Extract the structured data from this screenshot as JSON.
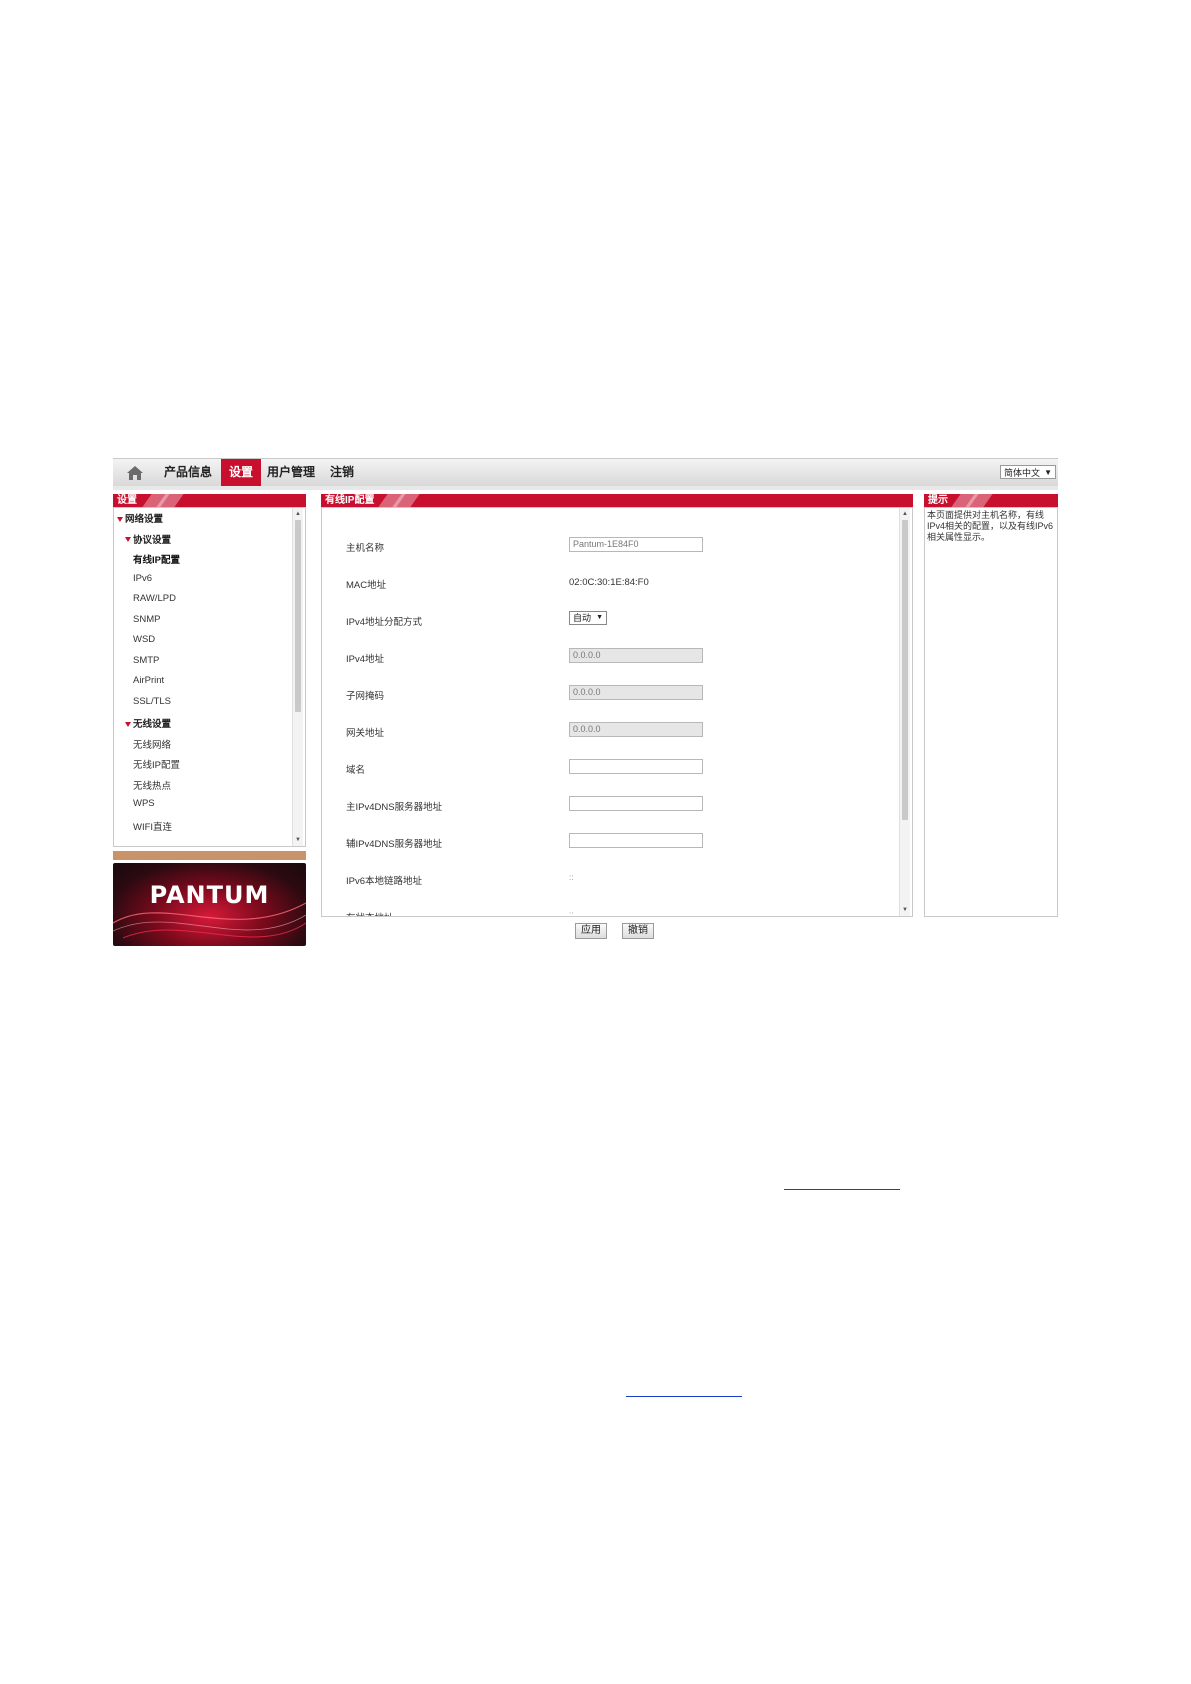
{
  "nav": {
    "items": [
      "产品信息",
      "设置",
      "用户管理",
      "注销"
    ],
    "active_index": 1,
    "language": "简体中文"
  },
  "sidebar": {
    "title": "设置",
    "tree": [
      {
        "label": "网络设置",
        "kind": "group",
        "level": 0
      },
      {
        "label": "协议设置",
        "kind": "group",
        "level": 1
      },
      {
        "label": "有线IP配置",
        "kind": "current",
        "level": 2
      },
      {
        "label": "IPv6",
        "kind": "item",
        "level": 2
      },
      {
        "label": "RAW/LPD",
        "kind": "item",
        "level": 2
      },
      {
        "label": "SNMP",
        "kind": "item",
        "level": 2
      },
      {
        "label": "WSD",
        "kind": "item",
        "level": 2
      },
      {
        "label": "SMTP",
        "kind": "item",
        "level": 2
      },
      {
        "label": "AirPrint",
        "kind": "item",
        "level": 2
      },
      {
        "label": "SSL/TLS",
        "kind": "item",
        "level": 2
      },
      {
        "label": "无线设置",
        "kind": "group",
        "level": 1
      },
      {
        "label": "无线网络",
        "kind": "item",
        "level": 2
      },
      {
        "label": "无线IP配置",
        "kind": "item",
        "level": 2
      },
      {
        "label": "无线热点",
        "kind": "item",
        "level": 2
      },
      {
        "label": "WPS",
        "kind": "item",
        "level": 2
      },
      {
        "label": "WIFI直连",
        "kind": "item",
        "level": 2
      }
    ]
  },
  "logo": {
    "text": "PANTUM"
  },
  "main": {
    "title": "有线IP配置",
    "fields": [
      {
        "label": "主机名称",
        "type": "input",
        "value": "Pantum-1E84F0"
      },
      {
        "label": "MAC地址",
        "type": "text",
        "value": "02:0C:30:1E:84:F0"
      },
      {
        "label": "IPv4地址分配方式",
        "type": "select",
        "value": "自动"
      },
      {
        "label": "IPv4地址",
        "type": "input-disabled",
        "value": "0.0.0.0"
      },
      {
        "label": "子网掩码",
        "type": "input-disabled",
        "value": "0.0.0.0"
      },
      {
        "label": "网关地址",
        "type": "input-disabled",
        "value": "0.0.0.0"
      },
      {
        "label": "域名",
        "type": "input",
        "value": ""
      },
      {
        "label": "主IPv4DNS服务器地址",
        "type": "input",
        "value": ""
      },
      {
        "label": "辅IPv4DNS服务器地址",
        "type": "input",
        "value": ""
      },
      {
        "label": "IPv6本地链路地址",
        "type": "tiny",
        "value": "::"
      },
      {
        "label": "有状态地址",
        "type": "tiny",
        "value": "::"
      }
    ],
    "apply_label": "应用",
    "cancel_label": "撤销"
  },
  "hint": {
    "title": "提示",
    "text": "本页面提供对主机名称，有线IPv4相关的配置，以及有线IPv6相关属性显示。"
  }
}
